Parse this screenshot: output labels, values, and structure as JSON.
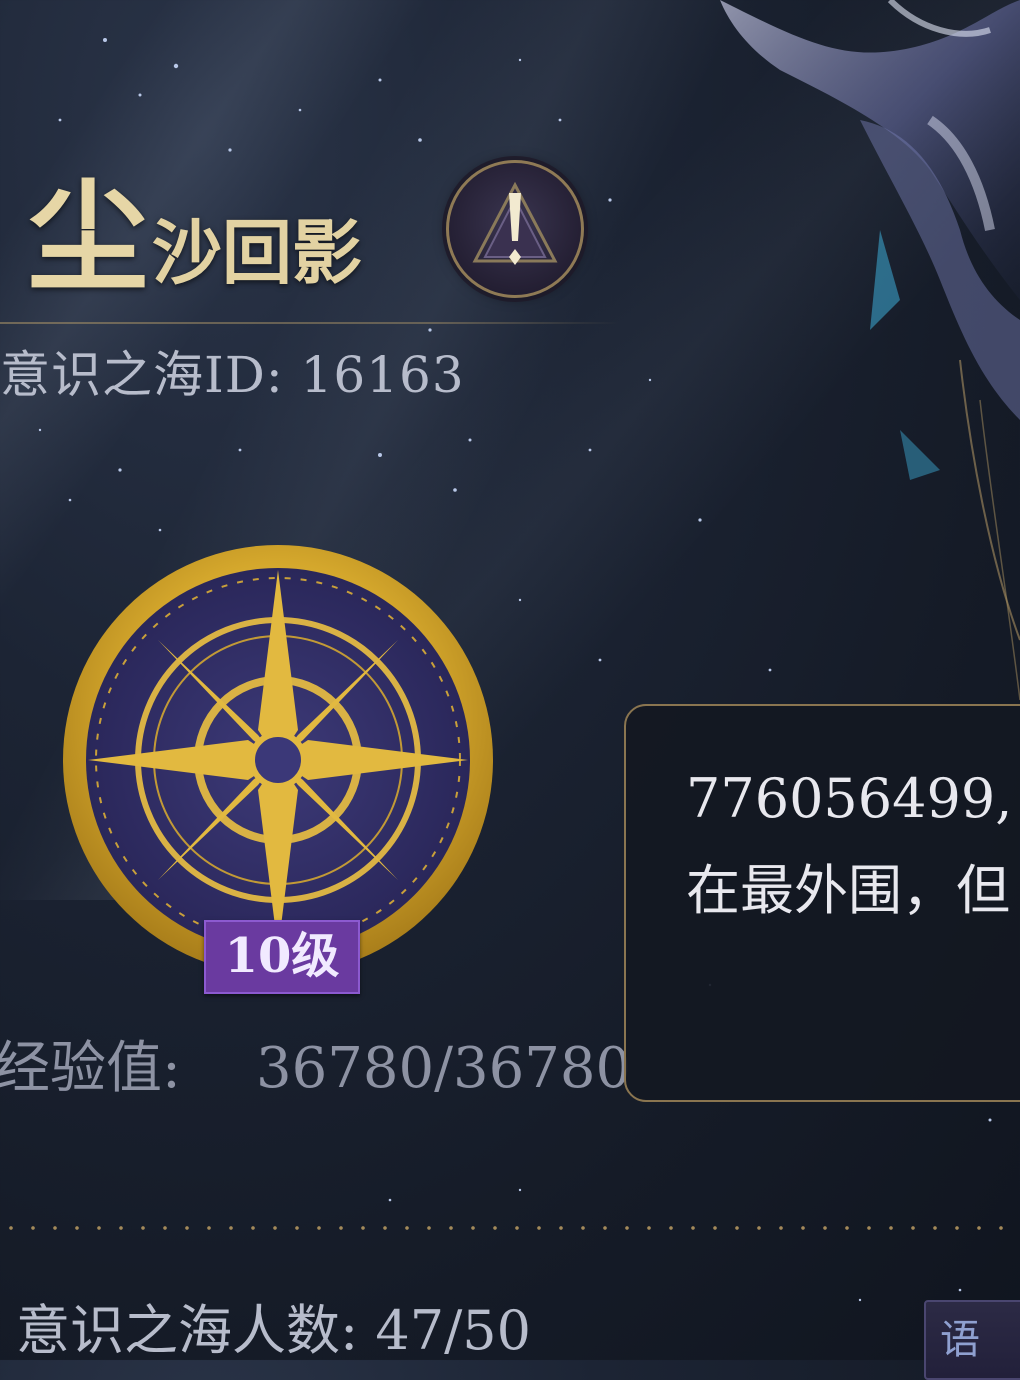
{
  "title": {
    "first_char": "尘",
    "rest": "沙回影"
  },
  "info_button": {
    "icon": "exclamation-triangle-icon"
  },
  "id_line": "意识之海ID: 16163",
  "level_badge": "10级",
  "experience": {
    "label": "经验值:",
    "value": "36780/36780",
    "progress": 1.0
  },
  "message": {
    "line1": "776056499,",
    "line2": "在最外围，但"
  },
  "members": "意识之海人数: 47/50",
  "side_button": {
    "label": "语"
  },
  "colors": {
    "gold": "#e6d6a6",
    "badge_purple": "#6a3aa0",
    "panel_border": "#8a7550"
  }
}
